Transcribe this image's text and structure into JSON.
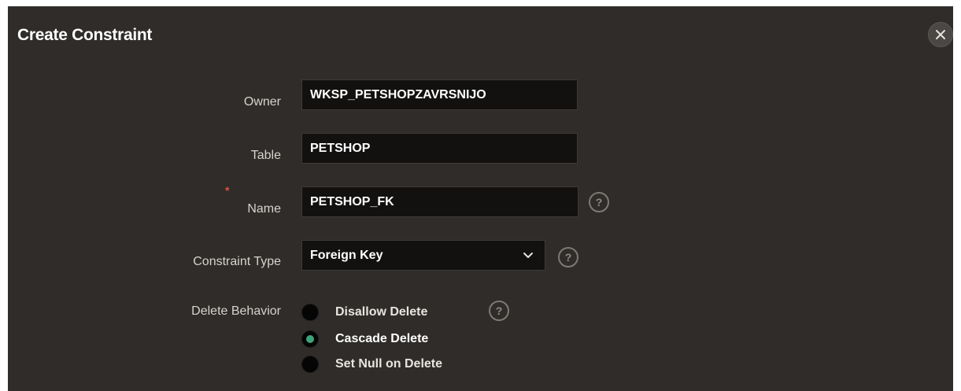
{
  "dialog": {
    "title": "Create Constraint"
  },
  "fields": {
    "owner": {
      "label": "Owner",
      "value": "WKSP_PETSHOPZAVRSNIJO"
    },
    "table": {
      "label": "Table",
      "value": "PETSHOP"
    },
    "name": {
      "label": "Name",
      "value": "PETSHOP_FK",
      "required_mark": "*"
    },
    "constraint_type": {
      "label": "Constraint Type",
      "value": "Foreign Key"
    },
    "delete_behavior": {
      "label": "Delete Behavior",
      "options": [
        {
          "label": "Disallow Delete",
          "checked": false
        },
        {
          "label": "Cascade Delete",
          "checked": true
        },
        {
          "label": "Set Null on Delete",
          "checked": false
        }
      ]
    }
  },
  "help_glyph": "?",
  "icons": {
    "close": "close-icon",
    "help": "help-icon",
    "dropdown": "chevron-down-icon"
  },
  "colors": {
    "background": "#2f2c29",
    "input_bg": "#121110",
    "required": "#e0503e",
    "radio_selected": "#3fa37a"
  }
}
